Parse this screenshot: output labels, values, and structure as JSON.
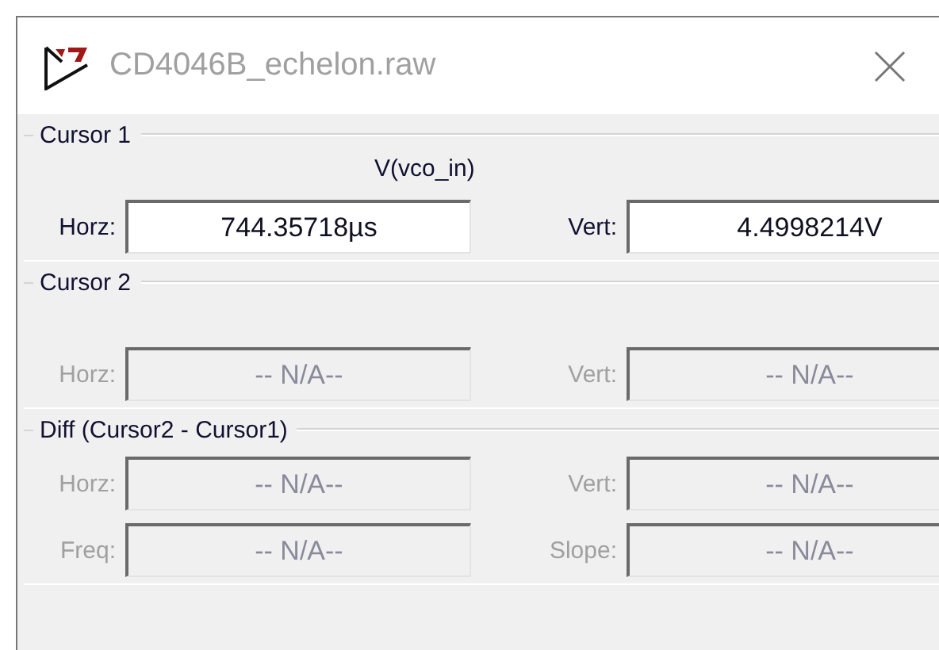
{
  "window": {
    "title": "CD4046B_echelon.raw"
  },
  "groups": [
    {
      "kind": "cursor",
      "title": "Cursor 1",
      "trace": "V(vco_in)",
      "rows": [
        [
          {
            "label": "Horz:",
            "value": "744.35718µs",
            "disabled": false
          },
          {
            "label": "Vert:",
            "value": "4.4998214V",
            "disabled": false
          }
        ]
      ]
    },
    {
      "kind": "cursor",
      "title": "Cursor 2",
      "rows": [
        [
          {
            "label": "Horz:",
            "value": "-- N/A--",
            "disabled": true
          },
          {
            "label": "Vert:",
            "value": "-- N/A--",
            "disabled": true
          }
        ]
      ]
    },
    {
      "kind": "diff",
      "title": "Diff (Cursor2 - Cursor1)",
      "rows": [
        [
          {
            "label": "Horz:",
            "value": "-- N/A--",
            "disabled": true
          },
          {
            "label": "Vert:",
            "value": "-- N/A--",
            "disabled": true
          }
        ],
        [
          {
            "label": "Freq:",
            "value": "-- N/A--",
            "disabled": true
          },
          {
            "label": "Slope:",
            "value": "-- N/A--",
            "disabled": true
          }
        ]
      ]
    }
  ]
}
